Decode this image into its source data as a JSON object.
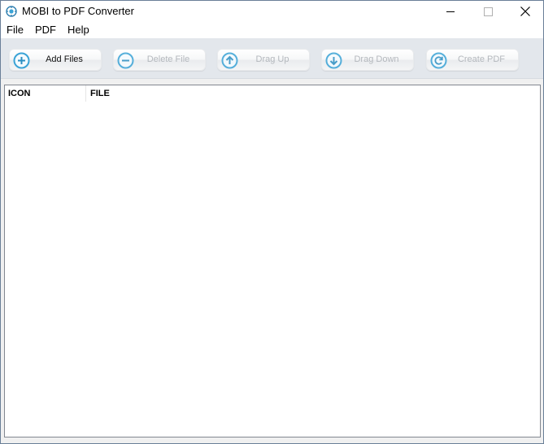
{
  "window": {
    "title": "MOBI to PDF Converter",
    "minimize_glyph": "—",
    "close_glyph": "✕"
  },
  "menu": {
    "items": [
      "File",
      "PDF",
      "Help"
    ]
  },
  "toolbar": {
    "buttons": [
      {
        "label": "Add Files",
        "icon": "plus-circle-icon",
        "enabled": true
      },
      {
        "label": "Delete File",
        "icon": "minus-circle-icon",
        "enabled": false
      },
      {
        "label": "Drag Up",
        "icon": "arrow-up-circle-icon",
        "enabled": false
      },
      {
        "label": "Drag Down",
        "icon": "arrow-down-circle-icon",
        "enabled": false
      },
      {
        "label": "Create PDF",
        "icon": "refresh-circle-icon",
        "enabled": false
      }
    ]
  },
  "list": {
    "columns": [
      "ICON",
      "FILE"
    ],
    "rows": []
  },
  "colors": {
    "accent": "#3aa3d6",
    "toolbar_bg": "#e3e7ec",
    "disabled_text": "#b4b8bd"
  }
}
